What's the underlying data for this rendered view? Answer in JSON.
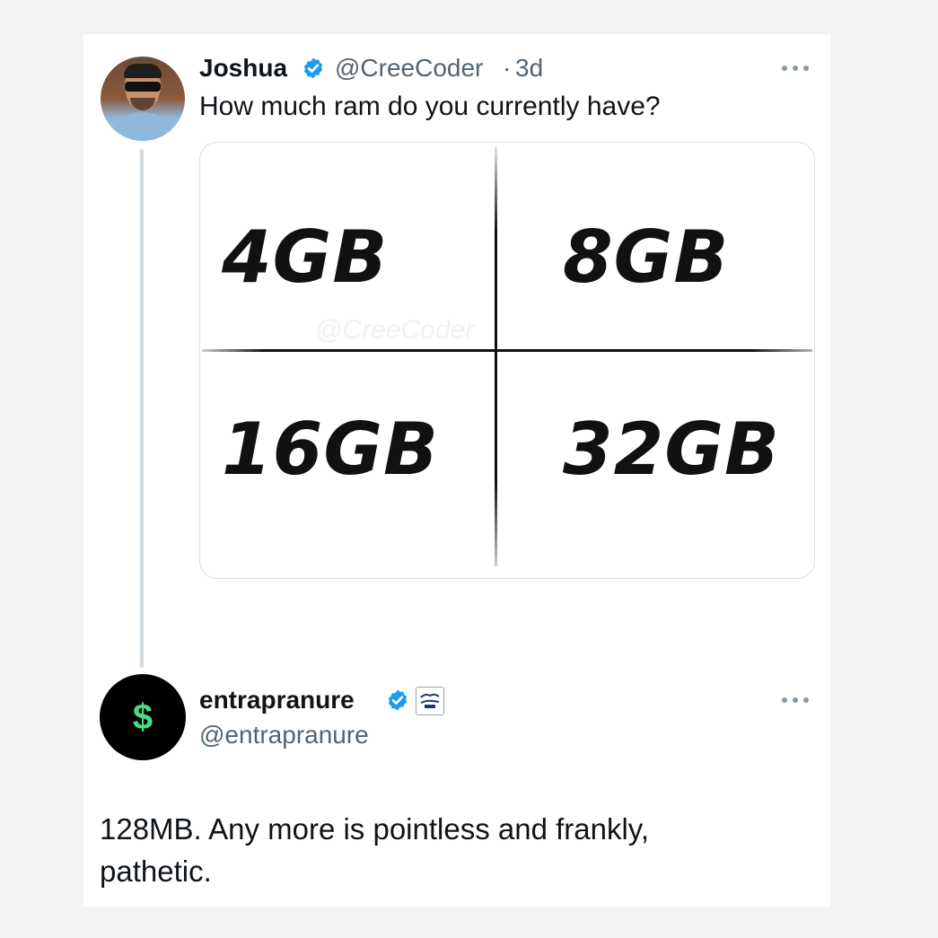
{
  "tweets": [
    {
      "author": "Joshua",
      "handle": "@CreeCoder",
      "separator": "·",
      "time": "3d",
      "text": "How much ram do you currently have?",
      "avatar_icon": "profile-photo-man-sunglasses",
      "verified_icon": "verified-badge-icon",
      "more_icon": "more-options-icon",
      "media": {
        "watermark": "@CreeCoder",
        "options": [
          "4GB",
          "8GB",
          "16GB",
          "32GB"
        ]
      }
    },
    {
      "author": "entrapranure",
      "handle": "@entrapranure",
      "text_line1": "128MB. Any more is pointless and frankly,",
      "text_line2": "pathetic.",
      "avatar_icon": "dollar-sign-icon",
      "avatar_glyph": "$",
      "verified_icon": "verified-badge-icon",
      "affiliate_icon": "affiliate-badge-icon",
      "more_icon": "more-options-icon"
    }
  ],
  "colors": {
    "text": "#0f1419",
    "muted": "#536471",
    "verified": "#1d9bf0",
    "thread_line": "#cfd9de",
    "dollar": "#4ade80"
  }
}
